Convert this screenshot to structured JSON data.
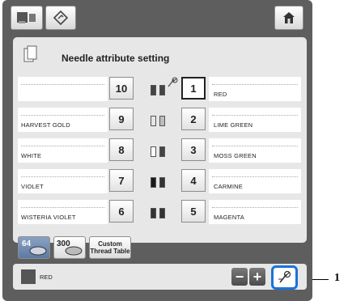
{
  "panel": {
    "title": "Needle attribute setting"
  },
  "rows": [
    {
      "left_num": "10",
      "left_name": "",
      "right_num": "1",
      "right_name": "RED",
      "spool_left": "#444444",
      "spool_right": "#444444"
    },
    {
      "left_num": "9",
      "left_name": "HARVEST GOLD",
      "right_num": "2",
      "right_name": "LIME GREEN",
      "spool_left": "#e5e5e5",
      "spool_right": "#bdbdbd"
    },
    {
      "left_num": "8",
      "left_name": "WHITE",
      "right_num": "3",
      "right_name": "MOSS GREEN",
      "spool_left": "#ffffff",
      "spool_right": "#444444"
    },
    {
      "left_num": "7",
      "left_name": "VIOLET",
      "right_num": "4",
      "right_name": "CARMINE",
      "spool_left": "#1a1a1a",
      "spool_right": "#333333"
    },
    {
      "left_num": "6",
      "left_name": "WISTERIA VIOLET",
      "right_num": "5",
      "right_name": "MAGENTA",
      "spool_left": "#333333",
      "spool_right": "#333333"
    }
  ],
  "palette_buttons": {
    "p64": "64",
    "p300": "300",
    "custom": "Custom Thread Table"
  },
  "status": {
    "color_name": "RED"
  },
  "callout": {
    "label": "1"
  },
  "colors": {
    "frame": "#5e5e5e",
    "panel": "#e7e7e7",
    "highlight": "#1a73d9"
  }
}
